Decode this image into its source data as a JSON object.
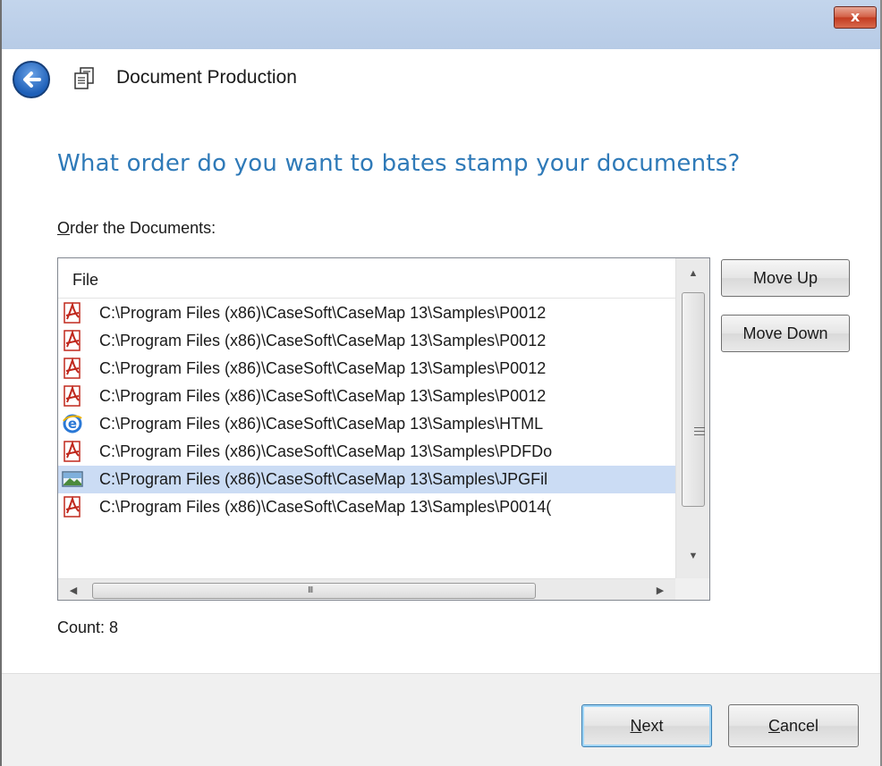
{
  "window": {
    "close_label": "x"
  },
  "header": {
    "title": "Document Production"
  },
  "main": {
    "heading": "What order do you want to bates stamp your documents?",
    "order_label_first": "O",
    "order_label_rest": "rder the Documents:",
    "column_header": "File",
    "files": [
      {
        "icon": "pdf-icon",
        "path": "C:\\Program Files (x86)\\CaseSoft\\CaseMap 13\\Samples\\P0012",
        "selected": false
      },
      {
        "icon": "pdf-icon",
        "path": "C:\\Program Files (x86)\\CaseSoft\\CaseMap 13\\Samples\\P0012",
        "selected": false
      },
      {
        "icon": "pdf-icon",
        "path": "C:\\Program Files (x86)\\CaseSoft\\CaseMap 13\\Samples\\P0012",
        "selected": false
      },
      {
        "icon": "pdf-icon",
        "path": "C:\\Program Files (x86)\\CaseSoft\\CaseMap 13\\Samples\\P0012",
        "selected": false
      },
      {
        "icon": "ie-html-icon",
        "path": "C:\\Program Files (x86)\\CaseSoft\\CaseMap 13\\Samples\\HTML",
        "selected": false
      },
      {
        "icon": "pdf-icon",
        "path": "C:\\Program Files (x86)\\CaseSoft\\CaseMap 13\\Samples\\PDFDo",
        "selected": false
      },
      {
        "icon": "image-icon",
        "path": "C:\\Program Files (x86)\\CaseSoft\\CaseMap 13\\Samples\\JPGFil",
        "selected": true
      },
      {
        "icon": "pdf-icon",
        "path": "C:\\Program Files (x86)\\CaseSoft\\CaseMap 13\\Samples\\P0014(",
        "selected": false
      }
    ],
    "hscroll_grip": "III",
    "move_up_label": "Move Up",
    "move_down_label": "Move Down",
    "count_text": "Count: 8"
  },
  "footer": {
    "next_first": "N",
    "next_rest": "ext",
    "cancel_first": "C",
    "cancel_rest": "ancel"
  },
  "colors": {
    "heading": "#2f7ab8",
    "selection": "#cbdcf4",
    "pdf_red": "#c0281d",
    "titlebar": "#c3d5ec"
  }
}
